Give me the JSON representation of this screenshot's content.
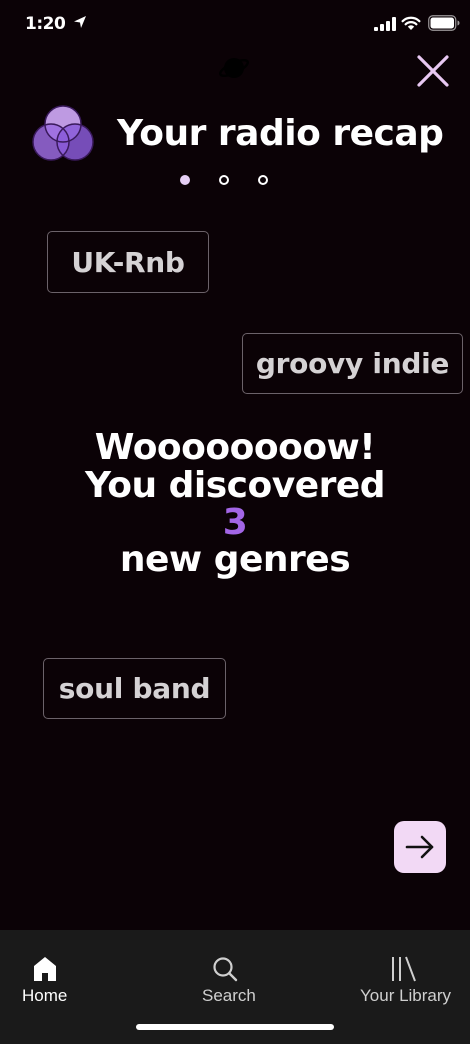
{
  "status_bar": {
    "time": "1:20"
  },
  "header": {
    "title": "Your radio recap"
  },
  "pager": {
    "pages": 3,
    "active_page": 1
  },
  "genres": [
    "UK-Rnb",
    "groovy indie",
    "soul band"
  ],
  "headline": {
    "line1": "Woooooooow!",
    "line2": "You discovered",
    "count": "3",
    "line3": "new genres"
  },
  "tab_bar": {
    "home_label": "Home",
    "search_label": "Search",
    "library_label": "Your Library",
    "active": "home"
  },
  "icons": {
    "close": "close-icon",
    "next": "arrow-right-icon",
    "logo": "venn-circles-icon",
    "planet": "planet-icon"
  },
  "colors": {
    "background": "#0b0206",
    "accent_purple": "#a366e6",
    "next_button": "#f2d9f5",
    "close_icon": "#e8c8f2",
    "active_dot": "#e6cff5",
    "tab_bar": "#1a1a1a"
  }
}
